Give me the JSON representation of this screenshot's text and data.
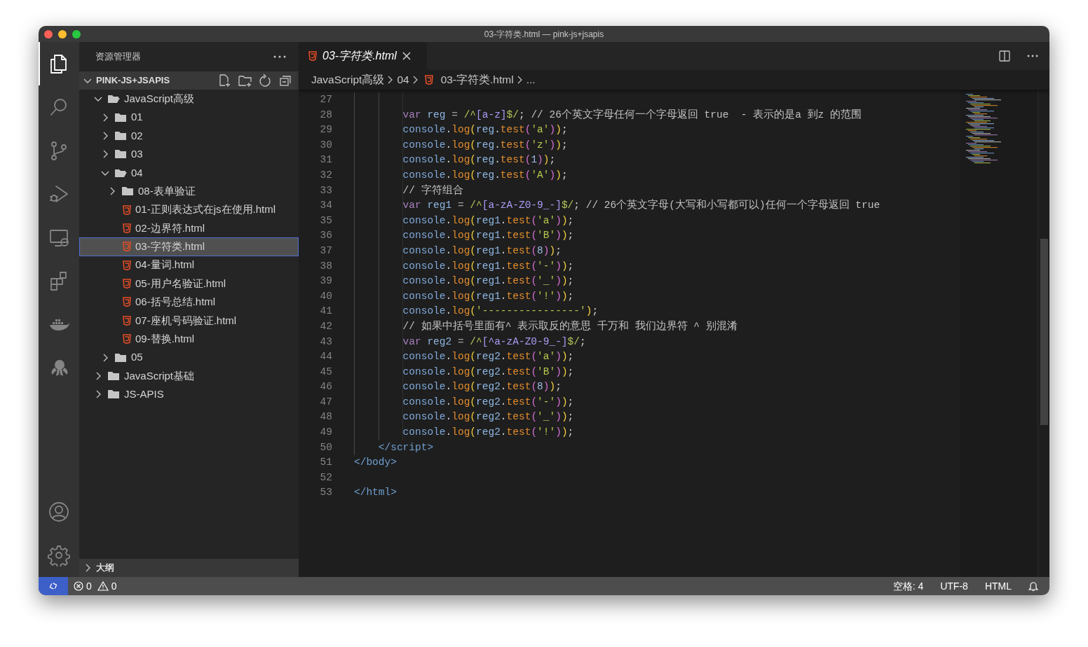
{
  "window": {
    "title": "03-字符类.html — pink-js+jsapis"
  },
  "activity_bar": {
    "items": [
      {
        "kind": "files",
        "selected": true
      },
      {
        "kind": "search",
        "selected": false
      },
      {
        "kind": "scm",
        "selected": false
      },
      {
        "kind": "debug",
        "selected": false
      },
      {
        "kind": "remote",
        "selected": false
      },
      {
        "kind": "extensions",
        "selected": false
      },
      {
        "kind": "docker",
        "selected": false
      },
      {
        "kind": "octopus",
        "selected": false
      }
    ],
    "bottom": [
      {
        "kind": "account"
      },
      {
        "kind": "settings"
      }
    ]
  },
  "sidebar": {
    "title": "资源管理器",
    "section": {
      "title": "PINK-JS+JSAPIS",
      "expanded": true,
      "actions": [
        {
          "kind": "new_file"
        },
        {
          "kind": "new_folder"
        },
        {
          "kind": "refresh"
        },
        {
          "kind": "collapse"
        }
      ]
    },
    "tree": [
      {
        "label": "JavaScript高级",
        "kind": "folder",
        "expanded": true,
        "selected": false,
        "children": [
          {
            "label": "01",
            "kind": "folder",
            "expanded": false,
            "selected": false
          },
          {
            "label": "02",
            "kind": "folder",
            "expanded": false,
            "selected": false
          },
          {
            "label": "03",
            "kind": "folder",
            "expanded": false,
            "selected": false
          },
          {
            "label": "04",
            "kind": "folder",
            "expanded": true,
            "selected": false,
            "children": [
              {
                "label": "08-表单验证",
                "kind": "folder",
                "expanded": false,
                "selected": false
              },
              {
                "label": "01-正则表达式在js在使用.html",
                "kind": "file",
                "selected": false
              },
              {
                "label": "02-边界符.html",
                "kind": "file",
                "selected": false
              },
              {
                "label": "03-字符类.html",
                "kind": "file",
                "selected": true
              },
              {
                "label": "04-量词.html",
                "kind": "file",
                "selected": false
              },
              {
                "label": "05-用户名验证.html",
                "kind": "file",
                "selected": false
              },
              {
                "label": "06-括号总结.html",
                "kind": "file",
                "selected": false
              },
              {
                "label": "07-座机号码验证.html",
                "kind": "file",
                "selected": false
              },
              {
                "label": "09-替换.html",
                "kind": "file",
                "selected": false
              }
            ]
          },
          {
            "label": "05",
            "kind": "folder",
            "expanded": false,
            "selected": false
          }
        ]
      },
      {
        "label": "JavaScript基础",
        "kind": "folder",
        "expanded": false,
        "selected": false
      },
      {
        "label": "JS-APIS",
        "kind": "folder",
        "expanded": false,
        "selected": false
      }
    ],
    "outline": {
      "title": "大纲",
      "expanded": false
    }
  },
  "editor": {
    "tabs": [
      {
        "label": "03-字符类.html",
        "selected": true,
        "preview": true
      }
    ],
    "breadcrumb": [
      {
        "label": "JavaScript高级",
        "kind": "folder"
      },
      {
        "label": "04",
        "kind": "folder"
      },
      {
        "label": "03-字符类.html",
        "kind": "file"
      },
      {
        "label": "...",
        "kind": "symbol"
      }
    ],
    "lines": [
      {
        "number": "27",
        "kind": "script"
      },
      {
        "number": "28",
        "kind": "script",
        "tokens": [
          {
            "kind": "kw",
            "text": "var"
          },
          {
            "kind": "ident",
            "text": " reg"
          },
          {
            "kind": "op",
            "text": " = "
          },
          {
            "kind": "regex",
            "text": "/^"
          },
          {
            "kind": "rclass",
            "text": "[a-z]"
          },
          {
            "kind": "regex",
            "text": "$/"
          },
          {
            "kind": "punct",
            "text": "; "
          },
          {
            "kind": "comment",
            "text": "// 26个英文字母任何一个字母返回 true  - 表示的是a 到z 的范围"
          }
        ]
      },
      {
        "number": "29",
        "kind": "script",
        "tokens": [
          {
            "kind": "obj",
            "text": "console"
          },
          {
            "kind": "punct",
            "text": "."
          },
          {
            "kind": "method",
            "text": "log"
          },
          {
            "kind": "b1",
            "text": "("
          },
          {
            "kind": "ident",
            "text": "reg"
          },
          {
            "kind": "punct",
            "text": "."
          },
          {
            "kind": "method",
            "text": "test"
          },
          {
            "kind": "b2",
            "text": "("
          },
          {
            "kind": "str",
            "text": "'a'"
          },
          {
            "kind": "b2",
            "text": ")"
          },
          {
            "kind": "b1",
            "text": ")"
          },
          {
            "kind": "punct",
            "text": ";"
          }
        ]
      },
      {
        "number": "30",
        "kind": "script",
        "tokens": [
          {
            "kind": "obj",
            "text": "console"
          },
          {
            "kind": "punct",
            "text": "."
          },
          {
            "kind": "method",
            "text": "log"
          },
          {
            "kind": "b1",
            "text": "("
          },
          {
            "kind": "ident",
            "text": "reg"
          },
          {
            "kind": "punct",
            "text": "."
          },
          {
            "kind": "method",
            "text": "test"
          },
          {
            "kind": "b2",
            "text": "("
          },
          {
            "kind": "str",
            "text": "'z'"
          },
          {
            "kind": "b2",
            "text": ")"
          },
          {
            "kind": "b1",
            "text": ")"
          },
          {
            "kind": "punct",
            "text": ";"
          }
        ]
      },
      {
        "number": "31",
        "kind": "script",
        "tokens": [
          {
            "kind": "obj",
            "text": "console"
          },
          {
            "kind": "punct",
            "text": "."
          },
          {
            "kind": "method",
            "text": "log"
          },
          {
            "kind": "b1",
            "text": "("
          },
          {
            "kind": "ident",
            "text": "reg"
          },
          {
            "kind": "punct",
            "text": "."
          },
          {
            "kind": "method",
            "text": "test"
          },
          {
            "kind": "b2",
            "text": "("
          },
          {
            "kind": "num",
            "text": "1"
          },
          {
            "kind": "b2",
            "text": ")"
          },
          {
            "kind": "b1",
            "text": ")"
          },
          {
            "kind": "punct",
            "text": ";"
          }
        ]
      },
      {
        "number": "32",
        "kind": "script",
        "tokens": [
          {
            "kind": "obj",
            "text": "console"
          },
          {
            "kind": "punct",
            "text": "."
          },
          {
            "kind": "method",
            "text": "log"
          },
          {
            "kind": "b1",
            "text": "("
          },
          {
            "kind": "ident",
            "text": "reg"
          },
          {
            "kind": "punct",
            "text": "."
          },
          {
            "kind": "method",
            "text": "test"
          },
          {
            "kind": "b2",
            "text": "("
          },
          {
            "kind": "str",
            "text": "'A'"
          },
          {
            "kind": "b2",
            "text": ")"
          },
          {
            "kind": "b1",
            "text": ")"
          },
          {
            "kind": "punct",
            "text": ";"
          }
        ]
      },
      {
        "number": "33",
        "kind": "script",
        "tokens": [
          {
            "kind": "comment",
            "text": "// 字符组合"
          }
        ]
      },
      {
        "number": "34",
        "kind": "script",
        "tokens": [
          {
            "kind": "kw",
            "text": "var"
          },
          {
            "kind": "ident",
            "text": " reg1"
          },
          {
            "kind": "op",
            "text": " = "
          },
          {
            "kind": "regex",
            "text": "/^"
          },
          {
            "kind": "rclass",
            "text": "[a-zA-Z0-9_-]"
          },
          {
            "kind": "regex",
            "text": "$/"
          },
          {
            "kind": "punct",
            "text": "; "
          },
          {
            "kind": "comment",
            "text": "// 26个英文字母(大写和小写都可以)任何一个字母返回 true"
          }
        ]
      },
      {
        "number": "35",
        "kind": "script",
        "tokens": [
          {
            "kind": "obj",
            "text": "console"
          },
          {
            "kind": "punct",
            "text": "."
          },
          {
            "kind": "method",
            "text": "log"
          },
          {
            "kind": "b1",
            "text": "("
          },
          {
            "kind": "ident",
            "text": "reg1"
          },
          {
            "kind": "punct",
            "text": "."
          },
          {
            "kind": "method",
            "text": "test"
          },
          {
            "kind": "b2",
            "text": "("
          },
          {
            "kind": "str",
            "text": "'a'"
          },
          {
            "kind": "b2",
            "text": ")"
          },
          {
            "kind": "b1",
            "text": ")"
          },
          {
            "kind": "punct",
            "text": ";"
          }
        ]
      },
      {
        "number": "36",
        "kind": "script",
        "tokens": [
          {
            "kind": "obj",
            "text": "console"
          },
          {
            "kind": "punct",
            "text": "."
          },
          {
            "kind": "method",
            "text": "log"
          },
          {
            "kind": "b1",
            "text": "("
          },
          {
            "kind": "ident",
            "text": "reg1"
          },
          {
            "kind": "punct",
            "text": "."
          },
          {
            "kind": "method",
            "text": "test"
          },
          {
            "kind": "b2",
            "text": "("
          },
          {
            "kind": "str",
            "text": "'B'"
          },
          {
            "kind": "b2",
            "text": ")"
          },
          {
            "kind": "b1",
            "text": ")"
          },
          {
            "kind": "punct",
            "text": ";"
          }
        ]
      },
      {
        "number": "37",
        "kind": "script",
        "tokens": [
          {
            "kind": "obj",
            "text": "console"
          },
          {
            "kind": "punct",
            "text": "."
          },
          {
            "kind": "method",
            "text": "log"
          },
          {
            "kind": "b1",
            "text": "("
          },
          {
            "kind": "ident",
            "text": "reg1"
          },
          {
            "kind": "punct",
            "text": "."
          },
          {
            "kind": "method",
            "text": "test"
          },
          {
            "kind": "b2",
            "text": "("
          },
          {
            "kind": "num",
            "text": "8"
          },
          {
            "kind": "b2",
            "text": ")"
          },
          {
            "kind": "b1",
            "text": ")"
          },
          {
            "kind": "punct",
            "text": ";"
          }
        ]
      },
      {
        "number": "38",
        "kind": "script",
        "tokens": [
          {
            "kind": "obj",
            "text": "console"
          },
          {
            "kind": "punct",
            "text": "."
          },
          {
            "kind": "method",
            "text": "log"
          },
          {
            "kind": "b1",
            "text": "("
          },
          {
            "kind": "ident",
            "text": "reg1"
          },
          {
            "kind": "punct",
            "text": "."
          },
          {
            "kind": "method",
            "text": "test"
          },
          {
            "kind": "b2",
            "text": "("
          },
          {
            "kind": "str",
            "text": "'-'"
          },
          {
            "kind": "b2",
            "text": ")"
          },
          {
            "kind": "b1",
            "text": ")"
          },
          {
            "kind": "punct",
            "text": ";"
          }
        ]
      },
      {
        "number": "39",
        "kind": "script",
        "tokens": [
          {
            "kind": "obj",
            "text": "console"
          },
          {
            "kind": "punct",
            "text": "."
          },
          {
            "kind": "method",
            "text": "log"
          },
          {
            "kind": "b1",
            "text": "("
          },
          {
            "kind": "ident",
            "text": "reg1"
          },
          {
            "kind": "punct",
            "text": "."
          },
          {
            "kind": "method",
            "text": "test"
          },
          {
            "kind": "b2",
            "text": "("
          },
          {
            "kind": "str",
            "text": "'_'"
          },
          {
            "kind": "b2",
            "text": ")"
          },
          {
            "kind": "b1",
            "text": ")"
          },
          {
            "kind": "punct",
            "text": ";"
          }
        ]
      },
      {
        "number": "40",
        "kind": "script",
        "tokens": [
          {
            "kind": "obj",
            "text": "console"
          },
          {
            "kind": "punct",
            "text": "."
          },
          {
            "kind": "method",
            "text": "log"
          },
          {
            "kind": "b1",
            "text": "("
          },
          {
            "kind": "ident",
            "text": "reg1"
          },
          {
            "kind": "punct",
            "text": "."
          },
          {
            "kind": "method",
            "text": "test"
          },
          {
            "kind": "b2",
            "text": "("
          },
          {
            "kind": "str",
            "text": "'!'"
          },
          {
            "kind": "b2",
            "text": ")"
          },
          {
            "kind": "b1",
            "text": ")"
          },
          {
            "kind": "punct",
            "text": ";"
          }
        ]
      },
      {
        "number": "41",
        "kind": "script",
        "tokens": [
          {
            "kind": "obj",
            "text": "console"
          },
          {
            "kind": "punct",
            "text": "."
          },
          {
            "kind": "method",
            "text": "log"
          },
          {
            "kind": "b1",
            "text": "("
          },
          {
            "kind": "str",
            "text": "'----------------'"
          },
          {
            "kind": "b1",
            "text": ")"
          },
          {
            "kind": "punct",
            "text": ";"
          }
        ]
      },
      {
        "number": "42",
        "kind": "script",
        "tokens": [
          {
            "kind": "comment",
            "text": "// 如果中括号里面有^ 表示取反的意思 千万和 我们边界符 ^ 别混淆"
          }
        ]
      },
      {
        "number": "43",
        "kind": "script",
        "tokens": [
          {
            "kind": "kw",
            "text": "var"
          },
          {
            "kind": "ident",
            "text": " reg2"
          },
          {
            "kind": "op",
            "text": " = "
          },
          {
            "kind": "regex",
            "text": "/^"
          },
          {
            "kind": "rclass",
            "text": "[^a-zA-Z0-9_-]"
          },
          {
            "kind": "regex",
            "text": "$/"
          },
          {
            "kind": "punct",
            "text": ";"
          }
        ]
      },
      {
        "number": "44",
        "kind": "script",
        "tokens": [
          {
            "kind": "obj",
            "text": "console"
          },
          {
            "kind": "punct",
            "text": "."
          },
          {
            "kind": "method",
            "text": "log"
          },
          {
            "kind": "b1",
            "text": "("
          },
          {
            "kind": "ident",
            "text": "reg2"
          },
          {
            "kind": "punct",
            "text": "."
          },
          {
            "kind": "method",
            "text": "test"
          },
          {
            "kind": "b2",
            "text": "("
          },
          {
            "kind": "str",
            "text": "'a'"
          },
          {
            "kind": "b2",
            "text": ")"
          },
          {
            "kind": "b1",
            "text": ")"
          },
          {
            "kind": "punct",
            "text": ";"
          }
        ]
      },
      {
        "number": "45",
        "kind": "script",
        "tokens": [
          {
            "kind": "obj",
            "text": "console"
          },
          {
            "kind": "punct",
            "text": "."
          },
          {
            "kind": "method",
            "text": "log"
          },
          {
            "kind": "b1",
            "text": "("
          },
          {
            "kind": "ident",
            "text": "reg2"
          },
          {
            "kind": "punct",
            "text": "."
          },
          {
            "kind": "method",
            "text": "test"
          },
          {
            "kind": "b2",
            "text": "("
          },
          {
            "kind": "str",
            "text": "'B'"
          },
          {
            "kind": "b2",
            "text": ")"
          },
          {
            "kind": "b1",
            "text": ")"
          },
          {
            "kind": "punct",
            "text": ";"
          }
        ]
      },
      {
        "number": "46",
        "kind": "script",
        "tokens": [
          {
            "kind": "obj",
            "text": "console"
          },
          {
            "kind": "punct",
            "text": "."
          },
          {
            "kind": "method",
            "text": "log"
          },
          {
            "kind": "b1",
            "text": "("
          },
          {
            "kind": "ident",
            "text": "reg2"
          },
          {
            "kind": "punct",
            "text": "."
          },
          {
            "kind": "method",
            "text": "test"
          },
          {
            "kind": "b2",
            "text": "("
          },
          {
            "kind": "num",
            "text": "8"
          },
          {
            "kind": "b2",
            "text": ")"
          },
          {
            "kind": "b1",
            "text": ")"
          },
          {
            "kind": "punct",
            "text": ";"
          }
        ]
      },
      {
        "number": "47",
        "kind": "script",
        "tokens": [
          {
            "kind": "obj",
            "text": "console"
          },
          {
            "kind": "punct",
            "text": "."
          },
          {
            "kind": "method",
            "text": "log"
          },
          {
            "kind": "b1",
            "text": "("
          },
          {
            "kind": "ident",
            "text": "reg2"
          },
          {
            "kind": "punct",
            "text": "."
          },
          {
            "kind": "method",
            "text": "test"
          },
          {
            "kind": "b2",
            "text": "("
          },
          {
            "kind": "str",
            "text": "'-'"
          },
          {
            "kind": "b2",
            "text": ")"
          },
          {
            "kind": "b1",
            "text": ")"
          },
          {
            "kind": "punct",
            "text": ";"
          }
        ]
      },
      {
        "number": "48",
        "kind": "script",
        "tokens": [
          {
            "kind": "obj",
            "text": "console"
          },
          {
            "kind": "punct",
            "text": "."
          },
          {
            "kind": "method",
            "text": "log"
          },
          {
            "kind": "b1",
            "text": "("
          },
          {
            "kind": "ident",
            "text": "reg2"
          },
          {
            "kind": "punct",
            "text": "."
          },
          {
            "kind": "method",
            "text": "test"
          },
          {
            "kind": "b2",
            "text": "("
          },
          {
            "kind": "str",
            "text": "'_'"
          },
          {
            "kind": "b2",
            "text": ")"
          },
          {
            "kind": "b1",
            "text": ")"
          },
          {
            "kind": "punct",
            "text": ";"
          }
        ]
      },
      {
        "number": "49",
        "kind": "script",
        "tokens": [
          {
            "kind": "obj",
            "text": "console"
          },
          {
            "kind": "punct",
            "text": "."
          },
          {
            "kind": "method",
            "text": "log"
          },
          {
            "kind": "b1",
            "text": "("
          },
          {
            "kind": "ident",
            "text": "reg2"
          },
          {
            "kind": "punct",
            "text": "."
          },
          {
            "kind": "method",
            "text": "test"
          },
          {
            "kind": "b2",
            "text": "("
          },
          {
            "kind": "str",
            "text": "'!'"
          },
          {
            "kind": "b2",
            "text": ")"
          },
          {
            "kind": "b1",
            "text": ")"
          },
          {
            "kind": "punct",
            "text": ";"
          }
        ]
      },
      {
        "number": "50",
        "kind": "body",
        "tokens": [
          {
            "kind": "tag",
            "text": "</script>"
          }
        ]
      },
      {
        "number": "51",
        "kind": "html",
        "tokens": [
          {
            "kind": "tag",
            "text": "</body>"
          }
        ]
      },
      {
        "number": "52",
        "kind": "html"
      },
      {
        "number": "53",
        "kind": "html",
        "tokens": [
          {
            "kind": "tag",
            "text": "</html>"
          }
        ]
      }
    ]
  },
  "status_bar": {
    "errors": "0",
    "warnings": "0",
    "items": [
      "空格: 4",
      "UTF-8",
      "HTML"
    ]
  }
}
